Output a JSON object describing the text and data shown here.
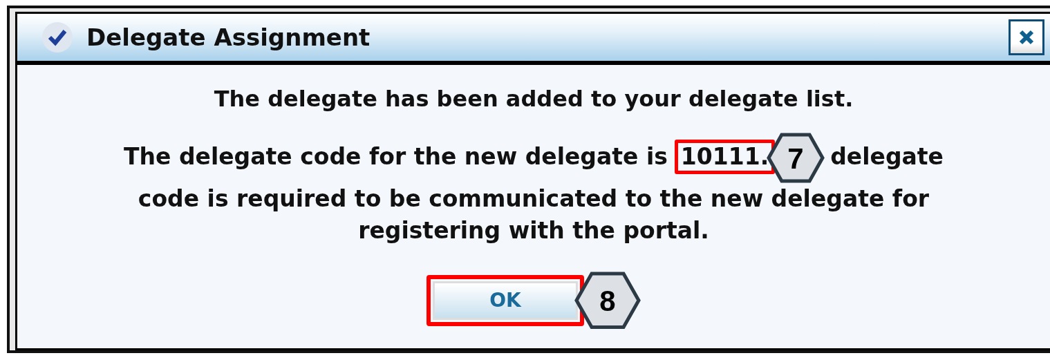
{
  "window": {
    "title": "Delegate Assignment"
  },
  "message": "The delegate has been added to your delegate list.",
  "detail": {
    "before": "The delegate code for the new delegate is",
    "code": {
      "text": "10111.",
      "highlighted": true,
      "callout": "7"
    },
    "after": "delegate",
    "more_lines": [
      "code is required to be communicated to the new delegate for",
      "registering with the portal."
    ]
  },
  "buttons": [
    {
      "label": "OK",
      "highlighted": true,
      "callout": "8"
    }
  ]
}
